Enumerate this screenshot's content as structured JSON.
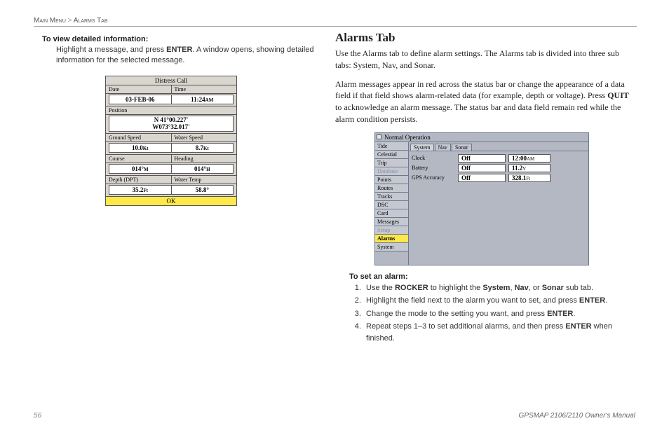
{
  "breadcrumb": {
    "a": "Main Menu",
    "sep": ">",
    "b": "Alarms Tab"
  },
  "left": {
    "heading": "To view detailed information:",
    "text_a": "Highlight a message, and press ",
    "text_key": "ENTER",
    "text_b": ". A window opens, showing detailed information for the selected message."
  },
  "distress": {
    "title": "Distress Call",
    "date_label": "Date",
    "time_label": "Time",
    "date_value": "03-FEB-06",
    "time_value": "11:24",
    "time_ampm": "AM",
    "position_label": "Position",
    "position_value_a": "N  41°00.227'",
    "position_value_b": "W073°32.017'",
    "ground_speed_label": "Ground Speed",
    "water_speed_label": "Water Speed",
    "ground_speed_value": "10.0",
    "ground_speed_unit": "Kt",
    "water_speed_value": "8.7",
    "water_speed_unit": "Kt",
    "course_label": "Course",
    "heading_label": "Heading",
    "course_value": "014°",
    "course_unit": "M",
    "heading_value": "014°",
    "heading_unit": "H",
    "depth_label": "Depth (DPT)",
    "water_temp_label": "Water Temp",
    "depth_value": "35.2",
    "depth_unit": "Ft",
    "water_temp_value": "58.8°",
    "ok": "OK"
  },
  "right": {
    "title": "Alarms Tab",
    "p1": "Use the Alarms tab to define alarm settings. The Alarms tab is divided into three sub tabs: System, Nav, and Sonar.",
    "p2a": "Alarm messages appear in red across the status bar or change the appearance of a data field if that field shows alarm-related data (for example, depth or voltage). Press ",
    "p2_key": "QUIT",
    "p2b": " to acknowledge an alarm message. The status bar and data field remain red while the alarm condition persists."
  },
  "alarmsfig": {
    "titlebar": "Normal Operation",
    "sidebar": [
      "Tide",
      "Celestial",
      "Trip",
      "Database",
      "Points",
      "Routes",
      "Tracks",
      "DSC",
      "Card",
      "Messages",
      "Setup",
      "Alarms",
      "System"
    ],
    "disabled": [
      "Database",
      "Setup"
    ],
    "selected": "Alarms",
    "tabs": [
      "System",
      "Nav",
      "Sonar"
    ],
    "rows": [
      {
        "label": "Clock",
        "v1": "Off",
        "v2": "12:00",
        "unit": "AM"
      },
      {
        "label": "Battery",
        "v1": "Off",
        "v2": "11.2",
        "unit": "V"
      },
      {
        "label": "GPS Accuracy",
        "v1": "Off",
        "v2": "328.1",
        "unit": "Ft"
      }
    ]
  },
  "steps": {
    "heading": "To set an alarm:",
    "s1a": "Use the ",
    "s1b": "ROCKER",
    "s1c": " to highlight the ",
    "s1d": "System",
    "s1e": ", ",
    "s1f": "Nav",
    "s1g": ", or ",
    "s1h": "Sonar",
    "s1i": " sub tab.",
    "s2a": "Highlight the field next to the alarm you want to set, and press ",
    "s2b": "ENTER",
    "s2c": ".",
    "s3a": "Change the mode to the setting you want, and press ",
    "s3b": "ENTER",
    "s3c": ".",
    "s4a": "Repeat steps 1–3 to set additional alarms, and then press ",
    "s4b": "ENTER",
    "s4c": " when finished."
  },
  "footer": {
    "page": "56",
    "manual": "GPSMAP 2106/2110 Owner's Manual"
  }
}
